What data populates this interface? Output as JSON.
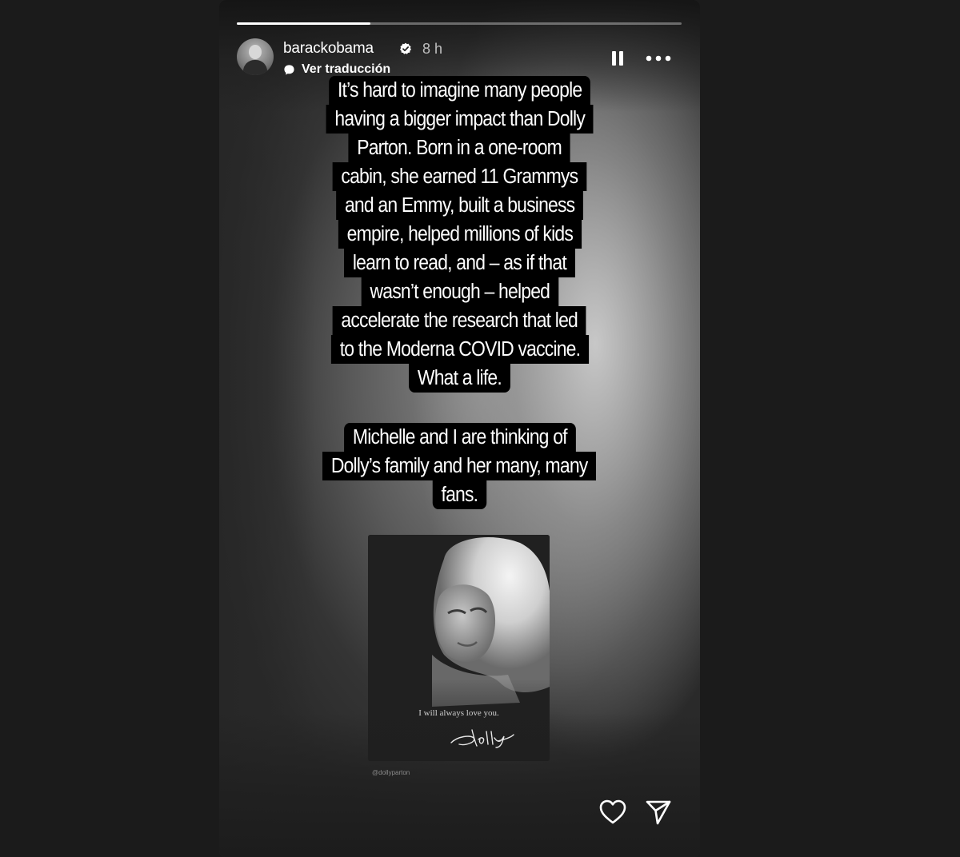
{
  "story": {
    "progress": 0.3,
    "user": {
      "username": "barackobama",
      "verified": true,
      "time_ago": "8 h",
      "avatar_icon": "profile-photo"
    },
    "translate_label": "Ver traducción",
    "controls": {
      "pause_icon": "pause-icon",
      "more_icon": "more-options-icon"
    },
    "caption_1": [
      "It’s hard to imagine many people",
      "having a bigger impact than Dolly",
      "Parton. Born in a one-room",
      "cabin, she earned 11 Grammys",
      "and an Emmy, built a business",
      "empire, helped millions of kids",
      "learn to read, and – as if that",
      "wasn’t enough – helped",
      "accelerate the research that led",
      "to the Moderna COVID vaccine.",
      "What a life."
    ],
    "caption_2": [
      "Michelle and I are thinking of",
      "Dolly’s family and her many, many",
      "fans."
    ],
    "embedded_post": {
      "quote": "I will always love you.",
      "signature": "Dolly",
      "credit": "@dollyparton"
    },
    "actions": {
      "like_icon": "heart-icon",
      "share_icon": "send-icon"
    },
    "colors": {
      "background": "#1b1b1b",
      "caption_bg": "#000000",
      "text": "#ffffff"
    }
  }
}
